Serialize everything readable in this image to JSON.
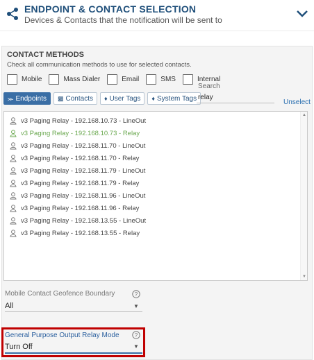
{
  "header": {
    "title": "ENDPOINT & CONTACT SELECTION",
    "subtitle": "Devices & Contacts that the notification will be sent to",
    "icon": "share-nodes-icon",
    "collapse_icon": "chevron-down-icon",
    "accent_color": "#1f4f7a"
  },
  "contact_methods": {
    "title": "CONTACT METHODS",
    "subtitle": "Check all communication methods to use for selected contacts.",
    "options": [
      {
        "label": "Mobile",
        "checked": false
      },
      {
        "label": "Mass Dialer",
        "checked": false
      },
      {
        "label": "Email",
        "checked": false
      },
      {
        "label": "SMS",
        "checked": false
      },
      {
        "label": "Internal",
        "checked": false
      }
    ]
  },
  "tabs": [
    {
      "label": "Endpoints",
      "icon": "share-icon",
      "active": true
    },
    {
      "label": "Contacts",
      "icon": "id-card-icon",
      "active": false
    },
    {
      "label": "User Tags",
      "icon": "tag-icon",
      "active": false
    },
    {
      "label": "System Tags",
      "icon": "tag-icon",
      "active": false
    }
  ],
  "search": {
    "label": "Search",
    "value": "relay"
  },
  "unselect_label": "Unselect",
  "endpoints": [
    {
      "label": "v3 Paging Relay - 192.168.10.73 - LineOut",
      "selected": false
    },
    {
      "label": "v3 Paging Relay - 192.168.10.73 - Relay",
      "selected": true
    },
    {
      "label": "v3 Paging Relay - 192.168.11.70 - LineOut",
      "selected": false
    },
    {
      "label": "v3 Paging Relay - 192.168.11.70 - Relay",
      "selected": false
    },
    {
      "label": "v3 Paging Relay - 192.168.11.79 - LineOut",
      "selected": false
    },
    {
      "label": "v3 Paging Relay - 192.168.11.79 - Relay",
      "selected": false
    },
    {
      "label": "v3 Paging Relay - 192.168.11.96 - LineOut",
      "selected": false
    },
    {
      "label": "v3 Paging Relay - 192.168.11.96 - Relay",
      "selected": false
    },
    {
      "label": "v3 Paging Relay - 192.168.13.55 - LineOut",
      "selected": false
    },
    {
      "label": "v3 Paging Relay - 192.168.13.55 - Relay",
      "selected": false
    }
  ],
  "geofence": {
    "label": "Mobile Contact Geofence Boundary",
    "value": "All",
    "help_icon": "help-circle-icon"
  },
  "relay_mode": {
    "label": "General Purpose Output Relay Mode",
    "value": "Turn Off",
    "help_icon": "help-circle-icon",
    "highlight_color": "#c00000"
  },
  "colors": {
    "selected_item": "#6aa84f",
    "active_tab": "#3a6ea5",
    "link": "#2a6fb0"
  }
}
